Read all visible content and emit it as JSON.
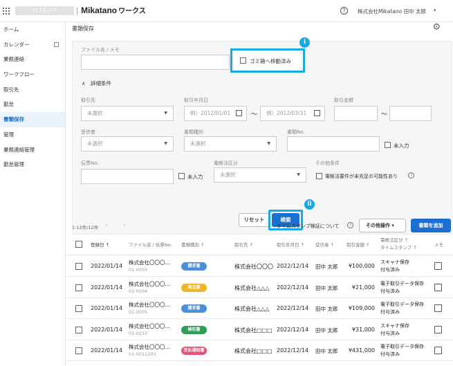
{
  "header": {
    "logo_area": "ロゴエリア",
    "brand": "Mikatano",
    "brand_sub": "ワークス",
    "help": "?",
    "company": "株式会社Mikatano  田中 太郎",
    "caret": "▾"
  },
  "sidebar": {
    "items": [
      {
        "label": "ホーム",
        "name": "home"
      },
      {
        "label": "カレンダー",
        "name": "calendar"
      },
      {
        "label": "業務連絡",
        "name": "business-contact"
      },
      {
        "label": "ワークフロー",
        "name": "workflow"
      },
      {
        "label": "取引先",
        "name": "clients"
      },
      {
        "label": "勤怠",
        "name": "attendance"
      },
      {
        "label": "書類保存",
        "name": "document-storage"
      },
      {
        "label": "管理",
        "name": "admin"
      },
      {
        "label": "業務連絡管理",
        "name": "business-contact-admin"
      },
      {
        "label": "勤怠管理",
        "name": "attendance-admin"
      }
    ],
    "active": "書類保存"
  },
  "page": {
    "title": "書類保存"
  },
  "search": {
    "file_label": "ファイル名 / メモ",
    "trash_label": "ゴミ箱へ移動済み",
    "badge1": "i",
    "detail_toggle": "∧　詳細条件",
    "client_label": "取引先",
    "client_value": "未選択",
    "date_label": "取引年月日",
    "date_from_placeholder": "例）2012/01/01",
    "date_to_placeholder": "例）2012/03/31",
    "tilde": "〜",
    "amount_label": "取引金額",
    "recipient_label": "受信者",
    "recipient_value": "未選択",
    "doctype_label": "書類種別",
    "doctype_value": "未選択",
    "docno_label": "書類No.",
    "unfilled": "未入力",
    "slip_label": "伝票No.",
    "law_label": "電帳法区分",
    "law_value": "未選択",
    "other_label": "その他条件",
    "other_check": "電帳法要件が未充足の可能性あり",
    "reset": "リセット",
    "search": "検索",
    "badge2": "ii"
  },
  "list": {
    "count": "1-12件/12件",
    "pager": "‹ ›",
    "ts_link": "タイムスタンプ検証について",
    "other_ops": "その他操作  ▾",
    "add_doc": "書類を追加",
    "headers": {
      "date": "登録日 ↑",
      "file": "ファイル名 / 伝票No.",
      "type": "書類種別 ↑",
      "client": "取引先 ↑",
      "txdate": "取引年月日 ↑",
      "recipient": "受信者 ↑",
      "amount": "取引金額 ↑",
      "law1": "電帳法区分 ↑",
      "law2": "タイムスタンプ ↑",
      "memo": "メモ"
    },
    "rows": [
      {
        "date": "2022/01/14",
        "file": "株式会社〇〇〇…",
        "no": "01-0003",
        "type": "請求書",
        "color": "#4a90d9",
        "client": "株式会社〇〇〇",
        "txdate": "2022/12/14",
        "recipient": "田中 太郎",
        "amount": "¥100,000",
        "law1": "スキャナ保存",
        "law2": "付与済み"
      },
      {
        "date": "2022/01/14",
        "file": "株式会社〇〇〇…",
        "no": "01-0004",
        "type": "発注書",
        "color": "#f0b429",
        "client": "株式会社△△△",
        "txdate": "2022/12/14",
        "recipient": "田中 太郎",
        "amount": "¥21,000",
        "law1": "電子取引データ保存",
        "law2": "付与済み"
      },
      {
        "date": "2022/01/14",
        "file": "株式会社〇〇〇…",
        "no": "01-0005",
        "type": "請求書",
        "color": "#4a90d9",
        "client": "株式会社△△△",
        "txdate": "2022/12/14",
        "recipient": "田中 太郎",
        "amount": "¥109,000",
        "law1": "電子取引データ保存",
        "law2": "付与済み"
      },
      {
        "date": "2022/01/14",
        "file": "株式会社〇〇〇…",
        "no": "01-0233",
        "type": "検収書",
        "color": "#2e9e5b",
        "client": "株式会社□□□",
        "txdate": "2022/12/14",
        "recipient": "田中 太郎",
        "amount": "¥31,000",
        "law1": "スキャナ保存",
        "law2": "付与済み"
      },
      {
        "date": "2022/01/14",
        "file": "株式会社〇〇〇…",
        "no": "01-0011203",
        "type": "支払通知書",
        "color": "#e0567a",
        "client": "株式会社□□□",
        "txdate": "2022/12/14",
        "recipient": "田中 太郎",
        "amount": "¥431,000",
        "law1": "電子取引データ保存",
        "law2": "付与済み"
      }
    ]
  },
  "colors": {
    "accent": "#1a6fd1",
    "highlight": "#17a9e6"
  }
}
